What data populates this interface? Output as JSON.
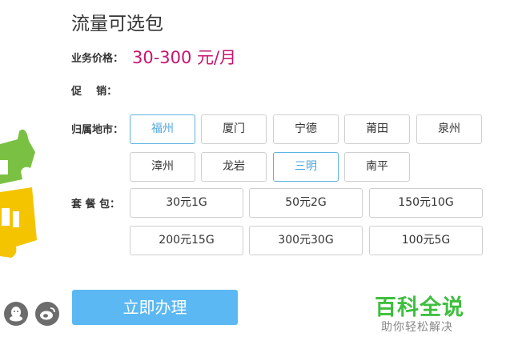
{
  "page": {
    "title": "流量可选包",
    "price_label": "业务价格：",
    "price_value": "30-300 元/月",
    "promo_label": "促    销：",
    "region_label": "归属地市：",
    "package_label": "套 餐 包："
  },
  "regions": [
    {
      "label": "福州",
      "selected": true
    },
    {
      "label": "厦门",
      "selected": false
    },
    {
      "label": "宁德",
      "selected": false
    },
    {
      "label": "莆田",
      "selected": false
    },
    {
      "label": "泉州",
      "selected": false
    },
    {
      "label": "漳州",
      "selected": false
    },
    {
      "label": "龙岩",
      "selected": false
    },
    {
      "label": "三明",
      "selected": true
    },
    {
      "label": "南平",
      "selected": false
    }
  ],
  "packages": [
    {
      "label": "30元1G"
    },
    {
      "label": "50元2G"
    },
    {
      "label": "150元10G"
    },
    {
      "label": "200元15G"
    },
    {
      "label": "300元30G"
    },
    {
      "label": "100元5G"
    }
  ],
  "actions": {
    "apply_label": "立即办理"
  },
  "watermark": {
    "title": "百科全说",
    "subtitle": "助你轻松解决"
  },
  "icons": [
    "qq-icon",
    "weibo-icon",
    "puzzle-decoration-icon"
  ],
  "colors": {
    "price": "#c8146e",
    "selected_border": "#5fb3e0",
    "button": "#5cb8f2",
    "watermark": "#3fbf3f"
  }
}
